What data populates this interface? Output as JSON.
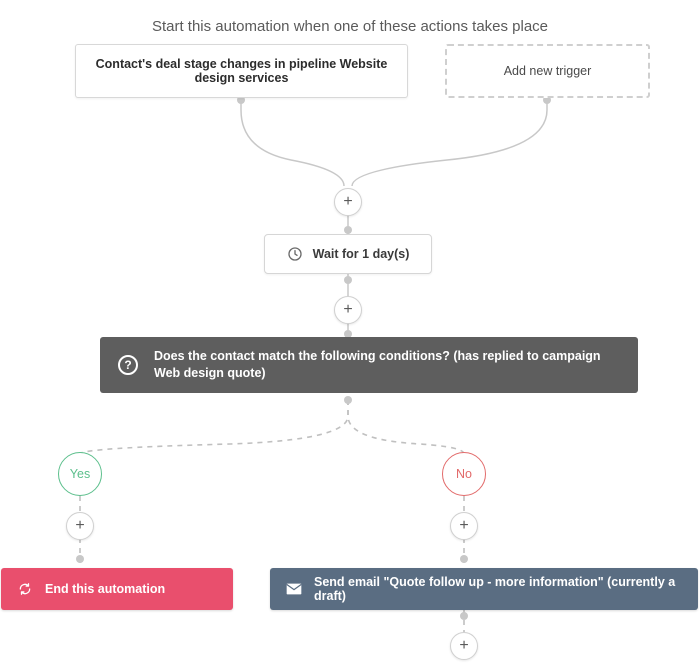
{
  "title": "Start this automation when one of these actions takes place",
  "trigger": {
    "primary_text": "Contact's deal stage changes in pipeline Website design services",
    "add_text": "Add new trigger"
  },
  "wait": {
    "label": "Wait for 1 day(s)"
  },
  "condition": {
    "prompt": "Does the contact match the following conditions? (has replied to campaign Web design quote)"
  },
  "branches": {
    "yes_label": "Yes",
    "no_label": "No"
  },
  "actions": {
    "end_label": "End this automation",
    "send_label": "Send email \"Quote follow up - more information\" (currently a draft)"
  }
}
